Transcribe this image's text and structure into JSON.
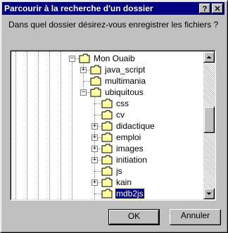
{
  "window": {
    "title": "Parcourir à la recherche d'un dossier",
    "help_label": "?",
    "close_label": "✕"
  },
  "prompt": "Dans quel dossier désirez-vous enregistrer les fichiers ?",
  "tree": {
    "items": [
      {
        "label": "Mon Ouaib",
        "expander": "−",
        "selected": false
      },
      {
        "label": "java_script",
        "expander": "+",
        "selected": false
      },
      {
        "label": "multimania",
        "expander": "",
        "selected": false
      },
      {
        "label": "ubiquitous",
        "expander": "−",
        "selected": false
      },
      {
        "label": "css",
        "expander": "",
        "selected": false
      },
      {
        "label": "cv",
        "expander": "",
        "selected": false
      },
      {
        "label": "didactique",
        "expander": "+",
        "selected": false
      },
      {
        "label": "emploi",
        "expander": "+",
        "selected": false
      },
      {
        "label": "images",
        "expander": "+",
        "selected": false
      },
      {
        "label": "initiation",
        "expander": "+",
        "selected": false
      },
      {
        "label": "js",
        "expander": "",
        "selected": false
      },
      {
        "label": "kain",
        "expander": "+",
        "selected": false
      },
      {
        "label": "mdb2js",
        "expander": "",
        "selected": true
      }
    ]
  },
  "scrollbar": {
    "up_icon": "▲",
    "down_icon": "▼"
  },
  "buttons": {
    "ok": "OK",
    "cancel": "Annuler"
  },
  "colors": {
    "titlebar": "#000080",
    "selection": "#000080",
    "folder": "#ffff99"
  }
}
